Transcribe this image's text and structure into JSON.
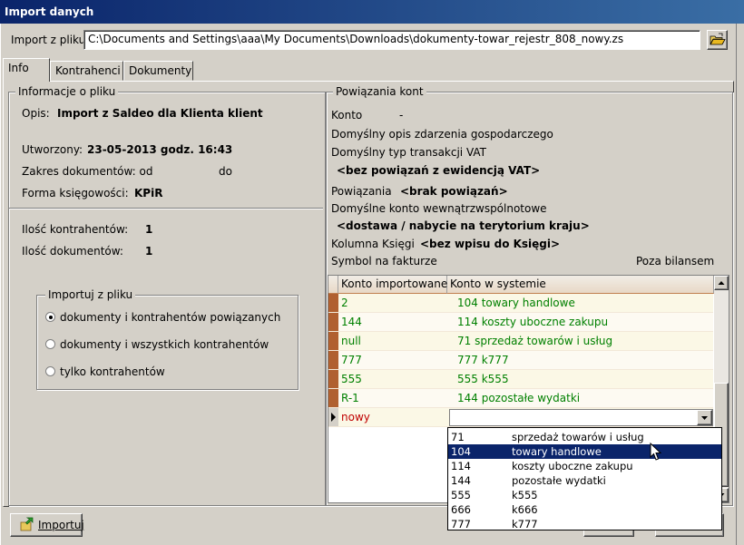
{
  "window": {
    "title": "Import danych"
  },
  "import_path": {
    "label": "Import z pliku",
    "value": "C:\\Documents and Settings\\aaa\\My Documents\\Downloads\\dokumenty-towar_rejestr_808_nowy.zs"
  },
  "tabs": [
    {
      "label": "Info"
    },
    {
      "label": "Kontrahenci"
    },
    {
      "label": "Dokumenty"
    }
  ],
  "file_info": {
    "title": "Informacje o pliku",
    "opis_label": "Opis:",
    "opis_value": "Import z Saldeo dla Klienta klient",
    "utworzony_label": "Utworzony:",
    "utworzony_value": "23-05-2013 godz. 16:43",
    "zakres_label": "Zakres dokumentów: od",
    "zakres_do": "do",
    "forma_label": "Forma księgowości:",
    "forma_value": "KPiR",
    "kontrahenci_label": "Ilość kontrahentów:",
    "kontrahenci_value": "1",
    "dokumenty_label": "Ilość dokumentów:",
    "dokumenty_value": "1"
  },
  "import_options": {
    "title": "Importuj z pliku",
    "options": [
      {
        "label": "dokumenty i kontrahentów powiązanych",
        "selected": true
      },
      {
        "label": "dokumenty i wszystkich kontrahentów",
        "selected": false
      },
      {
        "label": "tylko kontrahentów",
        "selected": false
      }
    ]
  },
  "accounts": {
    "title": "Powiązania kont",
    "konto_label": "Konto",
    "konto_value": "-",
    "opis_label": "Domyślny opis zdarzenia gospodarczego",
    "typ_label": "Domyślny typ  transakcji VAT",
    "typ_value": "<bez powiązań z ewidencją VAT>",
    "powiazania_label": "Powiązania",
    "powiazania_value": "<brak powiązań>",
    "wewn_label": "Domyślne konto wewnątrzwspólnotowe",
    "wewn_value": "<dostawa / nabycie na terytorium kraju>",
    "kolumna_label": "Kolumna Księgi",
    "kolumna_value": "<bez wpisu do Księgi>",
    "symbol_label": "Symbol na fakturze",
    "poza_label": "Poza bilansem"
  },
  "grid": {
    "headers": [
      "Konto importowane",
      "Konto w systemie"
    ],
    "rows": [
      {
        "imported": "2",
        "system": "104 towary handlowe"
      },
      {
        "imported": "144",
        "system": "114 koszty uboczne zakupu"
      },
      {
        "imported": "null",
        "system": " 71 sprzedaż towarów i usług"
      },
      {
        "imported": "777",
        "system": "777 k777"
      },
      {
        "imported": "555",
        "system": "555 k555"
      },
      {
        "imported": "R-1",
        "system": "144 pozostałe wydatki"
      }
    ],
    "new_row": "nowy"
  },
  "dropdown": {
    "items": [
      {
        "code": "71",
        "name": "sprzedaż towarów i usług"
      },
      {
        "code": "104",
        "name": "towary handlowe",
        "selected": true
      },
      {
        "code": "114",
        "name": "koszty uboczne zakupu"
      },
      {
        "code": "144",
        "name": "pozostałe wydatki"
      },
      {
        "code": "555",
        "name": "k555"
      },
      {
        "code": "666",
        "name": "k666"
      },
      {
        "code": "777",
        "name": "k777"
      }
    ]
  },
  "footer": {
    "import_button": "Importuj"
  },
  "colors": {
    "title_bar": "#0a246a",
    "grid_text": "#008000",
    "new_row_text": "#c00000",
    "selection": "#0a246a"
  },
  "icons": {
    "browse": "folder-open-icon",
    "import": "import-icon",
    "cursor": "mouse-pointer-icon"
  }
}
